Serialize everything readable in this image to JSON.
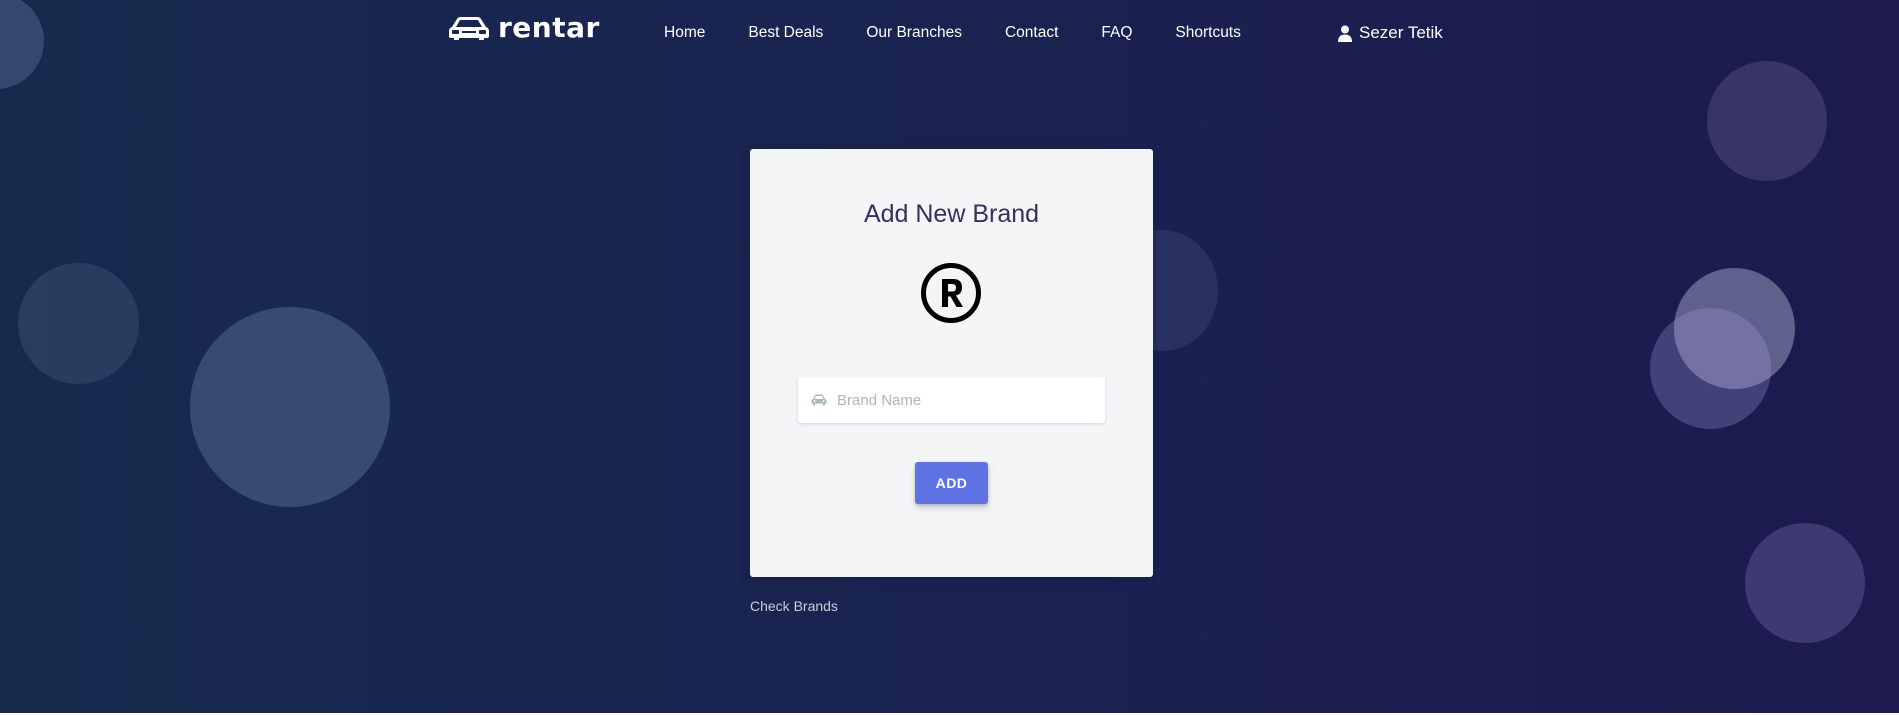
{
  "navbar": {
    "brand": "rentar",
    "links": [
      {
        "label": "Home"
      },
      {
        "label": "Best Deals"
      },
      {
        "label": "Our Branches"
      },
      {
        "label": "Contact"
      },
      {
        "label": "FAQ"
      },
      {
        "label": "Shortcuts"
      }
    ],
    "user_name": "Sezer Tetik",
    "icons": {
      "logo": "car-icon",
      "user": "user-icon"
    }
  },
  "card": {
    "title": "Add New Brand",
    "icon": "registered-trademark-icon",
    "brand_input": {
      "placeholder": "Brand Name",
      "value": "",
      "icon": "car-icon"
    },
    "add_button": "ADD"
  },
  "footer_link": "Check Brands",
  "colors": {
    "background_start": "#172a4e",
    "background_end": "#1c1a4f",
    "card_bg": "#f4f5f7",
    "title": "#32325d",
    "button": "#5e72e4",
    "link": "#c9cdd8"
  }
}
